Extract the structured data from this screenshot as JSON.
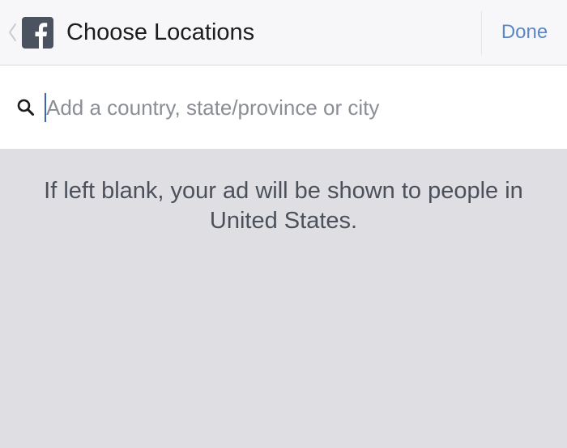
{
  "header": {
    "title": "Choose Locations",
    "done_label": "Done",
    "back_icon": "chevron-left-icon",
    "logo_icon": "facebook-logo-icon",
    "accent_color": "#5b87c7"
  },
  "search": {
    "placeholder": "Add a country, state/province or city",
    "value": "",
    "icon": "search-icon"
  },
  "main": {
    "info_text": "If left blank, your ad will be shown to people in United States."
  }
}
